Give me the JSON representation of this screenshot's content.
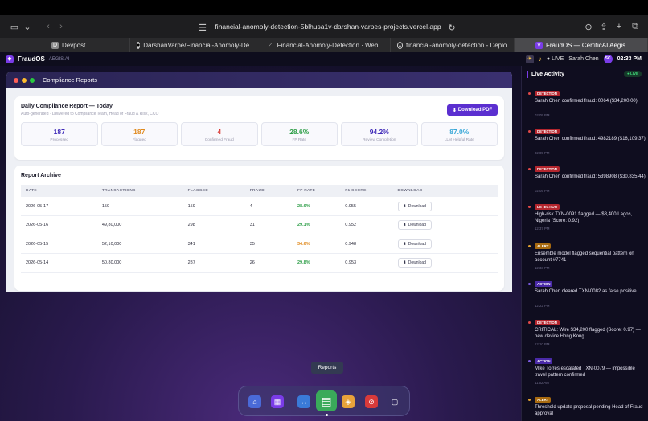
{
  "browser": {
    "url": "financial-anomoly-detection-5blhusa1v-darshan-varpes-projects.vercel.app",
    "tabs": [
      {
        "label": "Devpost",
        "icon": "devpost-icon",
        "color": "#8a8a8a"
      },
      {
        "label": "DarshanVarpe/Financial-Anomoly-De...",
        "icon": "github-icon",
        "color": "#d0d0d0"
      },
      {
        "label": "Financial-Anomoly-Detection · Web...",
        "icon": "link-icon",
        "color": "#d0d0d0"
      },
      {
        "label": "financial-anomoly-detection - Deplo...",
        "icon": "vercel-icon",
        "color": "#d0d0d0"
      },
      {
        "label": "FraudOS — CertificAI Aegis",
        "icon": "fraudos-icon",
        "color": "#7a3ce8",
        "active": true
      }
    ]
  },
  "appbar": {
    "brand": "FraudOS",
    "sub": "AEGIS.AI",
    "live": "● LIVE",
    "user": "Sarah Chen",
    "avatar": "SC",
    "time": "02:33 PM"
  },
  "window": {
    "title": "Compliance Reports"
  },
  "report": {
    "title": "Daily Compliance Report — Today",
    "subtitle": "Auto-generated · Delivered to Compliance Team, Head of Fraud & Risk, CCO",
    "download_label": "Download PDF",
    "stats": [
      {
        "value": "187",
        "label": "Processed",
        "color": "#3f2ab8"
      },
      {
        "value": "187",
        "label": "Flagged",
        "color": "#e08a1e"
      },
      {
        "value": "4",
        "label": "Confirmed Fraud",
        "color": "#d9322e"
      },
      {
        "value": "28.6%",
        "label": "FP Rate",
        "color": "#2e9e48"
      },
      {
        "value": "94.2%",
        "label": "Review Completion",
        "color": "#3f2ab8"
      },
      {
        "value": "87.0%",
        "label": "LLM Helpful Rate",
        "color": "#3aa8d8"
      }
    ]
  },
  "archive": {
    "title": "Report Archive",
    "columns": [
      "DATE",
      "TRANSACTIONS",
      "FLAGGED",
      "FRAUD",
      "FP RATE",
      "F1 SCORE",
      "DOWNLOAD"
    ],
    "download_label": "Download",
    "rows": [
      {
        "date": "2026-05-17",
        "transactions": "159",
        "flagged": "159",
        "fraud": "4",
        "fp": "28.6%",
        "fp_class": "fp-g",
        "f1": "0.955"
      },
      {
        "date": "2026-05-16",
        "transactions": "49,80,000",
        "flagged": "298",
        "fraud": "31",
        "fp": "29.1%",
        "fp_class": "fp-g",
        "f1": "0.952"
      },
      {
        "date": "2026-05-15",
        "transactions": "52,10,000",
        "flagged": "341",
        "fraud": "35",
        "fp": "34.6%",
        "fp_class": "fp-o",
        "f1": "0.948"
      },
      {
        "date": "2026-05-14",
        "transactions": "50,80,000",
        "flagged": "287",
        "fraud": "26",
        "fp": "29.8%",
        "fp_class": "fp-g",
        "f1": "0.953"
      }
    ]
  },
  "dock": {
    "tooltip": "Reports",
    "apps": [
      {
        "name": "home-app-icon",
        "glyph": "⌂",
        "color": "#4a6ad8"
      },
      {
        "name": "grid-app-icon",
        "glyph": "▦",
        "color": "#7a3ce8"
      },
      {
        "name": "transfer-app-icon",
        "glyph": "↔",
        "color": "#3a7ad8"
      },
      {
        "name": "reports-app-icon",
        "glyph": "▤",
        "color": "#3aaa5a",
        "active": true
      },
      {
        "name": "layers-app-icon",
        "glyph": "◈",
        "color": "#e8a23a"
      },
      {
        "name": "alert-app-icon",
        "glyph": "⊘",
        "color": "#d83a3a"
      },
      {
        "name": "clipboard-app-icon",
        "glyph": "▢",
        "color": "#8a8aa8"
      }
    ]
  },
  "activity": {
    "title": "Live Activity",
    "live": "● LIVE",
    "items": [
      {
        "tag": "DETECTION",
        "tag_color": "#b3262e",
        "dot": "#e04848",
        "text": "Sarah Chen confirmed fraud: 0064 ($34,200.00)",
        "time": "02:05 PM",
        "lines": 2
      },
      {
        "tag": "DETECTION",
        "tag_color": "#b3262e",
        "dot": "#e04848",
        "text": "Sarah Chen confirmed fraud: 4982189 ($16,109.37)",
        "time": "02:05 PM",
        "lines": 2
      },
      {
        "tag": "DETECTION",
        "tag_color": "#b3262e",
        "dot": "#e04848",
        "text": "Sarah Chen confirmed fraud: 5398908 ($30,835.44)",
        "time": "02:05 PM",
        "lines": 2
      },
      {
        "tag": "DETECTION",
        "tag_color": "#b3262e",
        "dot": "#e04848",
        "text": "High-risk TXN-0091 flagged — $8,400 Lagos, Nigeria (Score: 0.92)",
        "time": "12:37 PM",
        "lines": 2
      },
      {
        "tag": "ALERT",
        "tag_color": "#a86a10",
        "dot": "#e0a030",
        "text": "Ensemble model flagged sequential pattern on account #7741",
        "time": "12:33 PM",
        "lines": 2
      },
      {
        "tag": "ACTION",
        "tag_color": "#4a2aa8",
        "dot": "#7a5ae0",
        "text": "Sarah Chen cleared TXN-0082 as false positive",
        "time": "12:22 PM",
        "lines": 2
      },
      {
        "tag": "DETECTION",
        "tag_color": "#b3262e",
        "dot": "#e04848",
        "text": "CRITICAL: Wire $34,200 flagged (Score: 0.97) — new device Hong Kong",
        "time": "12:10 PM",
        "lines": 2
      },
      {
        "tag": "ACTION",
        "tag_color": "#4a2aa8",
        "dot": "#7a5ae0",
        "text": "Mike Torres escalated TXN-0079 — impossible travel pattern confirmed",
        "time": "11:52 AM",
        "lines": 2
      },
      {
        "tag": "ALERT",
        "tag_color": "#a86a10",
        "dot": "#e0a030",
        "text": "Threshold update proposal pending Head of Fraud approval",
        "time": "",
        "lines": 2
      }
    ]
  }
}
